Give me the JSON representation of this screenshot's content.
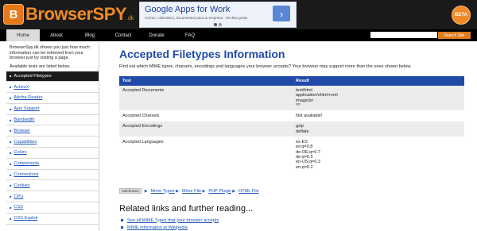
{
  "header": {
    "logo_icon": "B",
    "logo_text": "BrowserSPY",
    "logo_suffix": ".dk",
    "beta_badge": "BETA"
  },
  "ad": {
    "title": "Google Apps for Work",
    "subtitle": "Correo, calendario, documentos para tu empresa - 30 días gratis",
    "button_glyph": "›"
  },
  "nav": {
    "items": [
      "Home",
      "About",
      "Blog",
      "Contact",
      "Donate",
      "FAQ"
    ],
    "active_index": 0,
    "search_button": "Search Site"
  },
  "sidebar": {
    "intro": "BrowserSpy.dk shows you just how much information can be retrieved from your browser just by visiting a page.",
    "available": "Available tests are listed below.",
    "items": [
      "Accepted Filetypes",
      "ActiveX",
      "Adobe Reader",
      "Ajax Support",
      "Bandwidth",
      "Browser",
      "Capabilities",
      "Colors",
      "Components",
      "Connections",
      "Cookies",
      "CPU",
      "CSS",
      "CSS Exploit"
    ],
    "active_index": 0
  },
  "main": {
    "title": "Accepted Filetypes Information",
    "description": "Find out which MIME types, charsets, encodings and languages your browser accepts? Your browser may support more than the ones shown below.",
    "table": {
      "headers": [
        "Test",
        "Result"
      ],
      "rows": [
        {
          "test": "Accepted Documents",
          "result": [
            "text/html",
            "application/xhtml+xml",
            "image/jxr",
            "*/*"
          ]
        },
        {
          "test": "Accepted Charsets",
          "result": [
            "Not available!"
          ]
        },
        {
          "test": "Accepted Encodings",
          "result": [
            "gzip",
            "deflate"
          ]
        },
        {
          "test": "Accepted Languages",
          "result": [
            "es-ES",
            "es;q=0.8",
            "de-DE;q=0.7",
            "de;q=0.5",
            "en-US;q=0.3",
            "en;q=0.2"
          ]
        }
      ]
    },
    "adchoices": "AdChoices",
    "ad_links": [
      "Mime Types",
      "Mime File",
      "PHP Plugin",
      "HTML File"
    ],
    "related_title": "Related links and further reading...",
    "related_links": [
      "See all MIME Types that your browser accepts",
      "MIME information at Wikipedia"
    ]
  },
  "colors": {
    "accent": "#1f4aa8",
    "brand_orange": "#f08a24",
    "topbar": "#1a1a1a"
  }
}
